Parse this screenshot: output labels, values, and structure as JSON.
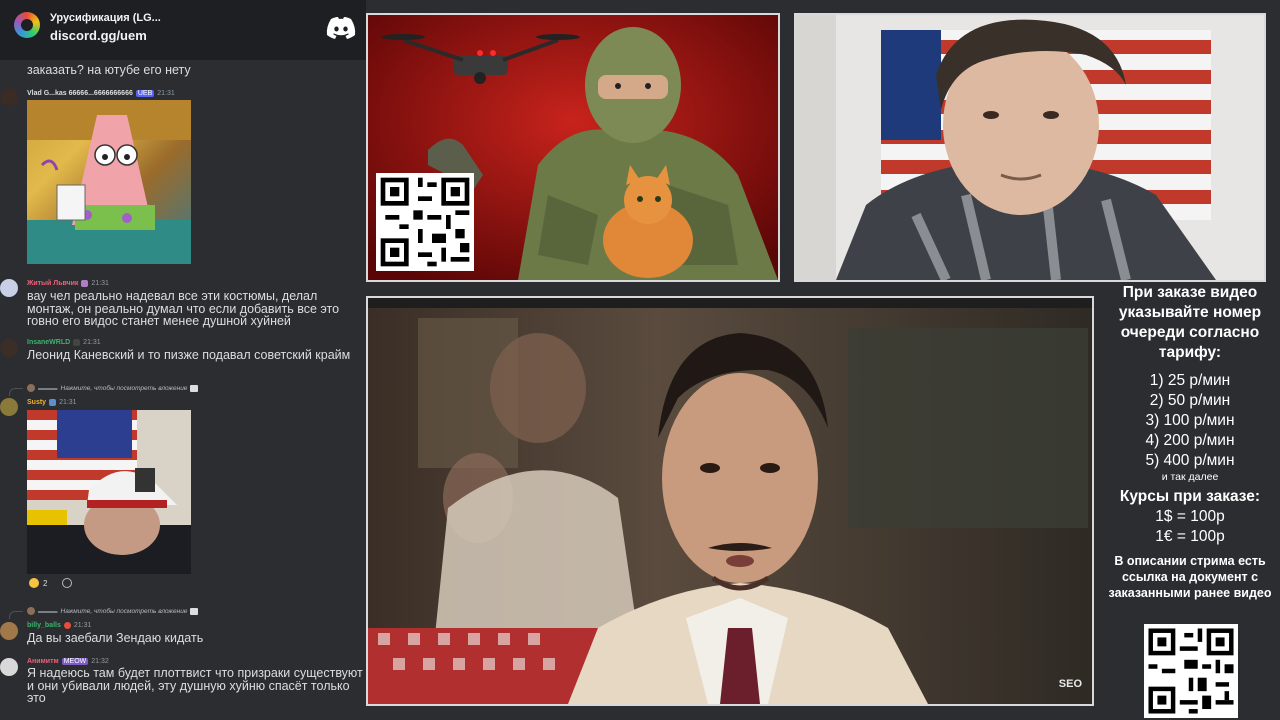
{
  "server": {
    "name": "Урусификация (LG...",
    "invite": "discord.gg/uem"
  },
  "chat": {
    "top_line": "заказать? на ютубе его нету",
    "messages": [
      {
        "user": "Vlad G...kas 66666...6666666666",
        "badge": "UEB",
        "time": "21:31"
      },
      {
        "user": "Житый Львчик",
        "time": "21:31",
        "text": "вау чел реально надевал все эти костюмы, делал монтаж, он реально думал что если добавить все это говно его видос станет менее душной хуйней"
      },
      {
        "user": "InsaneWRLD",
        "time": "21:31",
        "text": "Леонид Каневский и то пизже подавал советский крайм"
      },
      {
        "reply": "Нажмите, чтобы посмотреть вложение",
        "user": "Susty",
        "time": "21:31",
        "reaction_count": "2"
      },
      {
        "reply": "Нажмите, чтобы посмотреть вложение",
        "user": "billy_balls",
        "time": "21:31",
        "text": "Да вы заебали Зендаю кидать"
      },
      {
        "user": "Анимитм",
        "badge": "MEOW",
        "time": "21:32",
        "text": "Я надеюсь там будет плоттвист что призраки существуют и они убивали людей, эту душную хуйню спасёт только это"
      }
    ]
  },
  "video": {
    "watermark": "SEO"
  },
  "info": {
    "heading": "При заказе видео указывайте номер очереди согласно тарифу:",
    "tiers": [
      "1) 25 р/мин",
      "2) 50 р/мин",
      "3) 100 р/мин",
      "4) 200 р/мин",
      "5) 400 р/мин"
    ],
    "etc": "и так далее",
    "rates_title": "Курсы при заказе:",
    "rates": [
      "1$ = 100р",
      "1€ = 100р"
    ],
    "note": "В описании стрима есть ссылка на документ с заказанными ранее видео"
  },
  "colors": {
    "chat_bg": "#2b2d31",
    "header_bg": "#1e1f22",
    "page_bg": "#2b2d31",
    "panel_border": "#d9d9d9"
  },
  "icons": {
    "discord": "discord-logo-icon",
    "attachment": "image-icon"
  }
}
